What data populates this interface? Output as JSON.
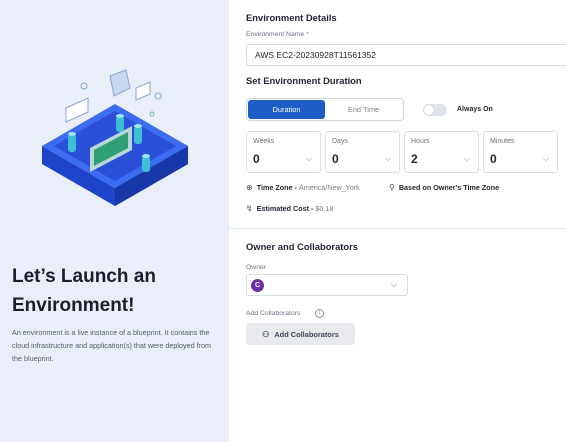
{
  "hero": {
    "title": "Let’s Launch an Environment!",
    "description": "An environment is a live instance of a blueprint. It contains the cloud infrastructure and application(s) that were deployed from the blueprint."
  },
  "details": {
    "heading": "Environment Details",
    "name_label": "Environment Name *",
    "name_value": "AWS EC2-20230928T11561352"
  },
  "duration": {
    "heading": "Set Environment Duration",
    "tabs": [
      "Duration",
      "End Time"
    ],
    "active_tab": "Duration",
    "always_on_label": "Always On",
    "always_on": false,
    "fields": [
      {
        "label": "Weeks",
        "value": "0"
      },
      {
        "label": "Days",
        "value": "0"
      },
      {
        "label": "Hours",
        "value": "2"
      },
      {
        "label": "Minutes",
        "value": "0"
      }
    ],
    "timezone_label": "Time Zone -",
    "timezone_value": "America/New_York",
    "based_on": "Based on Owner's Time Zone",
    "cost_label": "Estimated Cost -",
    "cost_value": "$0.18"
  },
  "owner": {
    "heading": "Owner and Collaborators",
    "owner_label": "Owner",
    "avatar_letter": "C",
    "add_label": "Add Collaborators",
    "add_button": "Add Collaborators"
  },
  "colors": {
    "accent": "#1c5ec6",
    "left_bg": "#e9eef8"
  },
  "icons": {
    "timezone": "globe-icon",
    "based_on": "location-pin-icon",
    "cost": "trend-icon",
    "add": "add-person-icon",
    "info": "info-icon",
    "dropdown": "chevron-down-icon"
  }
}
